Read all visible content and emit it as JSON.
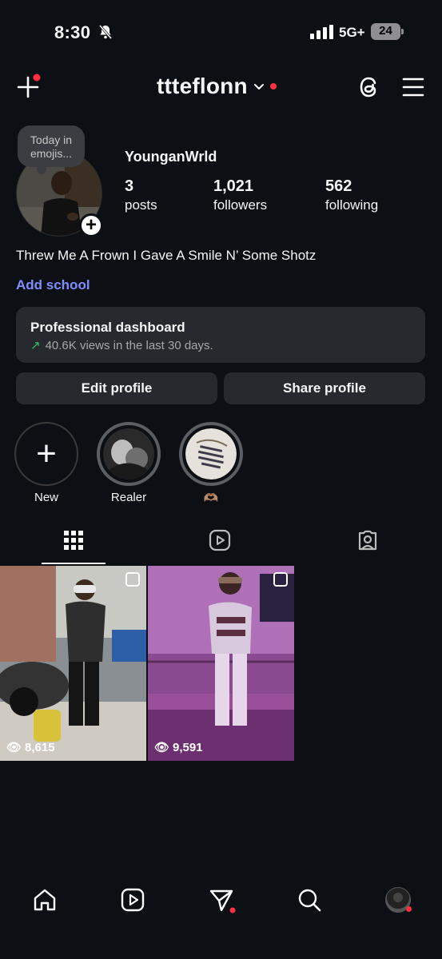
{
  "status_bar": {
    "time": "8:30",
    "network": "5G+",
    "battery": "24"
  },
  "header": {
    "username": "ttteflonn"
  },
  "profile": {
    "note": "Today in emojis...",
    "display_name": "YounganWrld",
    "stats": [
      {
        "value": "3",
        "label": "posts"
      },
      {
        "value": "1,021",
        "label": "followers"
      },
      {
        "value": "562",
        "label": "following"
      }
    ],
    "bio": "Threw Me A Frown I Gave A Smile N’ Some Shotz",
    "add_school": "Add school"
  },
  "dashboard": {
    "title": "Professional dashboard",
    "subtitle": "40.6K views in the last 30 days."
  },
  "buttons": {
    "edit": "Edit profile",
    "share": "Share profile"
  },
  "highlights": [
    {
      "label": "New"
    },
    {
      "label": "Realer"
    },
    {
      "label": "🫶🏽"
    }
  ],
  "posts": [
    {
      "views": "8,615"
    },
    {
      "views": "9,591"
    }
  ],
  "colors": {
    "accent_link": "#7f8dff",
    "notification": "#ff3040",
    "trend_up": "#36c060"
  }
}
